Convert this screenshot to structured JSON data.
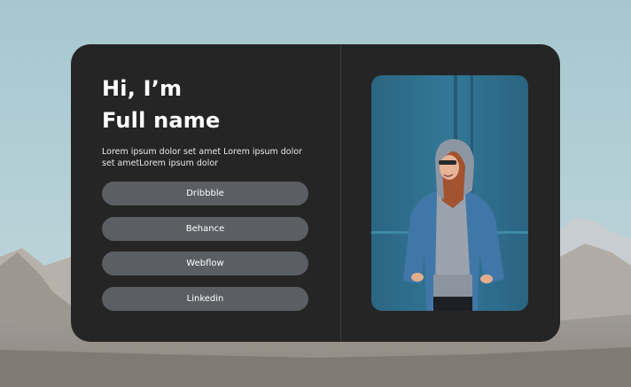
{
  "profile": {
    "greeting": "Hi, I’m",
    "name": "Full name",
    "description": "Lorem ipsum dolor set amet Lorem ipsum dolor set ametLorem ipsum dolor"
  },
  "links": [
    {
      "label": "Dribbble"
    },
    {
      "label": "Behance"
    },
    {
      "label": "Webflow"
    },
    {
      "label": "Linkedin"
    }
  ],
  "colors": {
    "card": "#252525",
    "button": "#5b5e63",
    "sky": "#a9c8d0",
    "photo_wall": "#2f6f8f"
  },
  "icons": {
    "photo": "portrait-photo"
  }
}
